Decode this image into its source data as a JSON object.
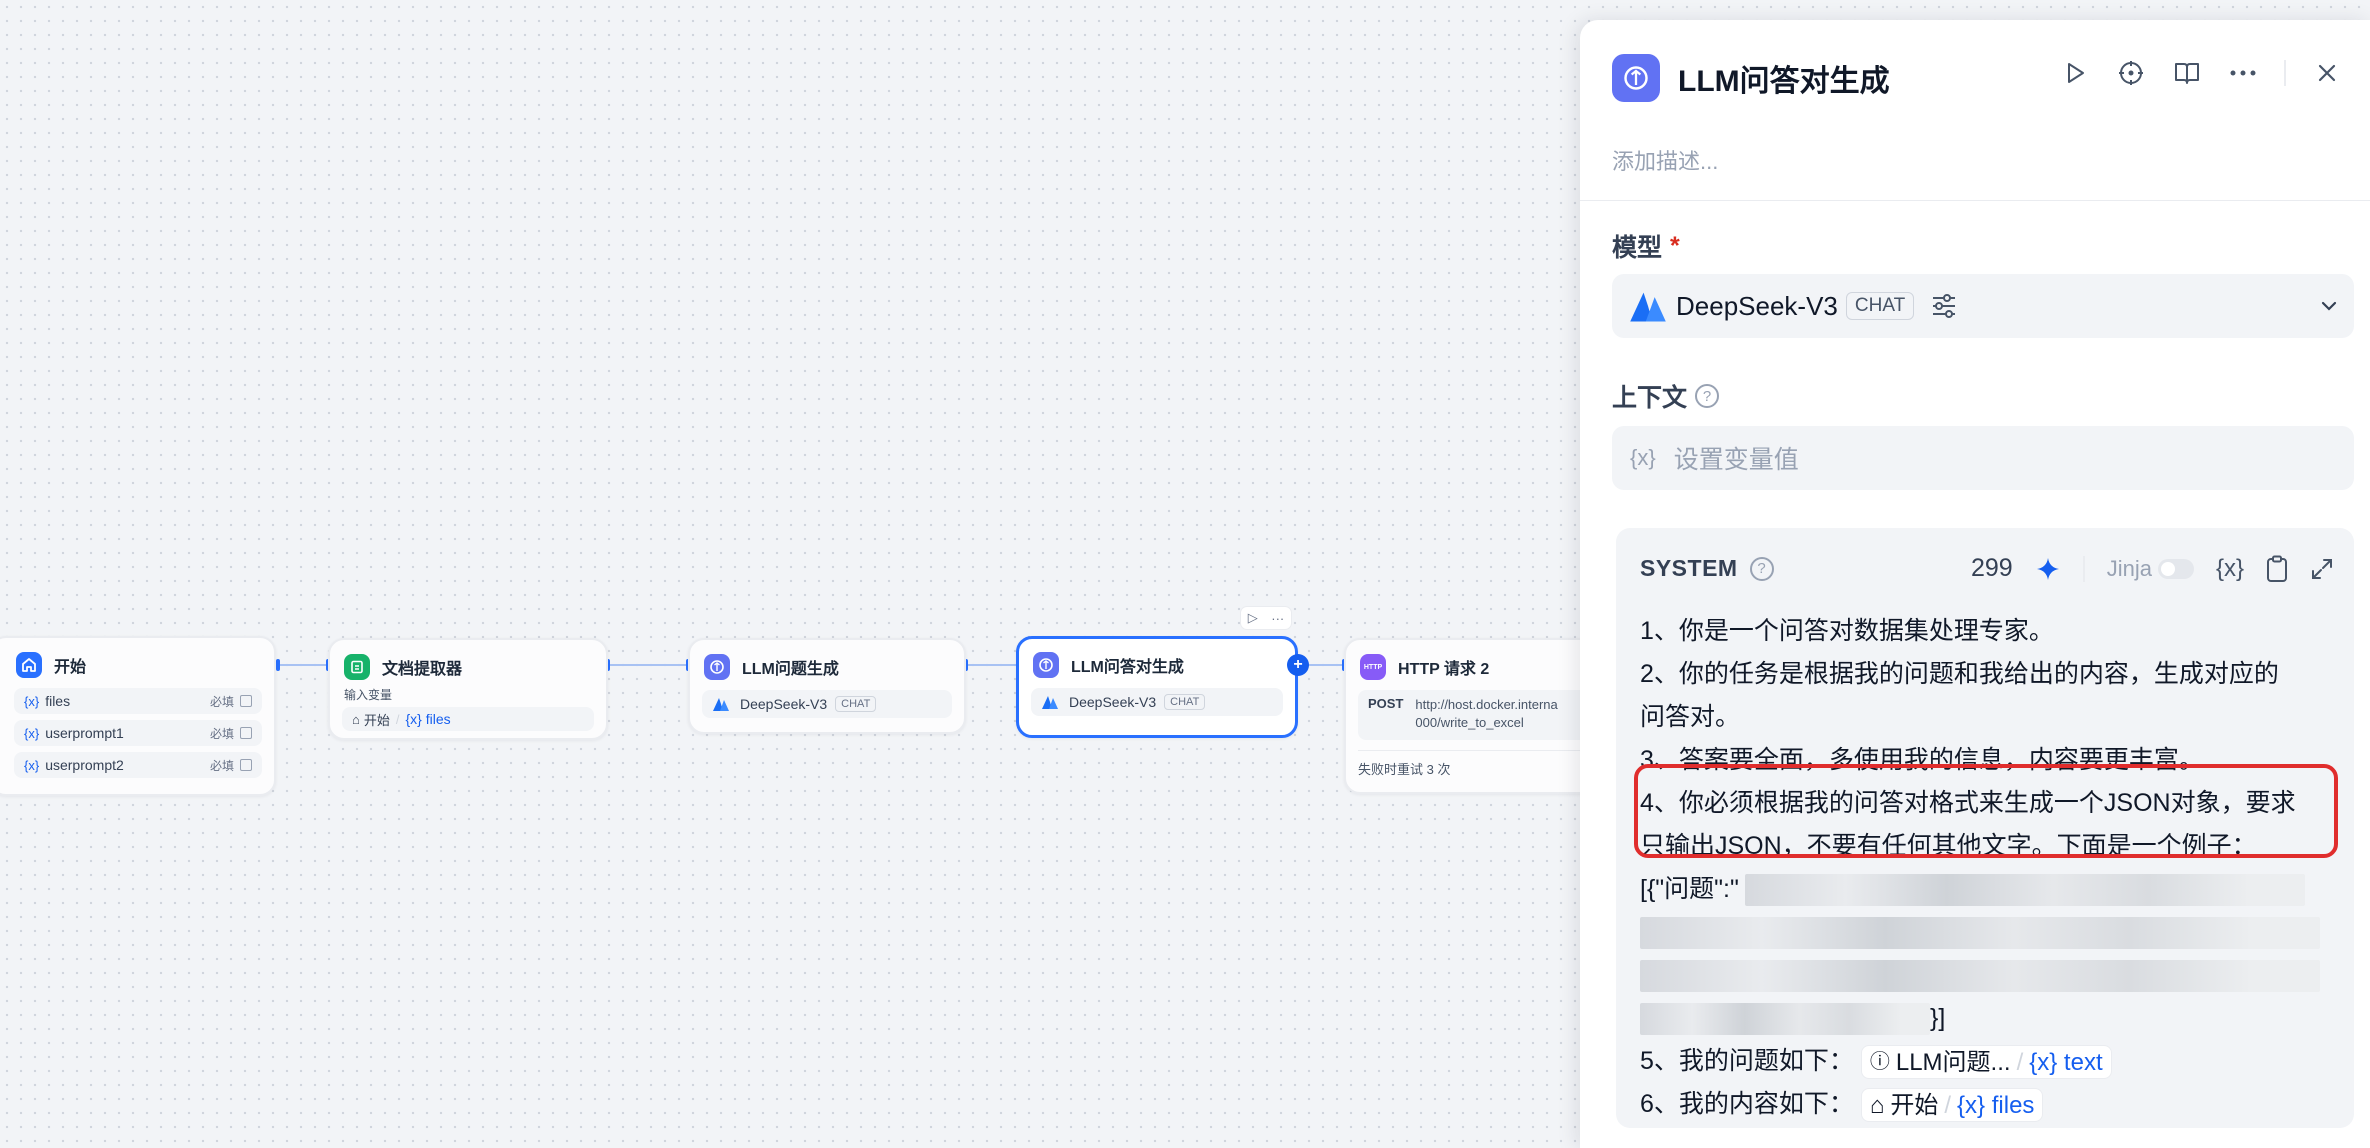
{
  "canvas": {
    "nodes": {
      "start": {
        "title": "开始",
        "vars": [
          {
            "icon": "{x}",
            "name": "files",
            "required": "必填"
          },
          {
            "icon": "{x}",
            "name": "userprompt1",
            "required": "必填"
          },
          {
            "icon": "{x}",
            "name": "userprompt2",
            "required": "必填"
          }
        ]
      },
      "doc_extractor": {
        "title": "文档提取器",
        "input_label": "输入变量",
        "input_node": "开始",
        "input_sep": "/",
        "input_var": "{x} files"
      },
      "llm_question": {
        "title": "LLM问题生成",
        "model": "DeepSeek-V3",
        "badge": "CHAT"
      },
      "llm_qa": {
        "title": "LLM问答对生成",
        "model": "DeepSeek-V3",
        "badge": "CHAT"
      },
      "http": {
        "title": "HTTP 请求 2",
        "method": "POST",
        "url_line1": "http://host.docker.interna",
        "url_line2": "000/write_to_excel",
        "retry": "失败时重试 3 次",
        "icon_text": "HTTP"
      }
    }
  },
  "panel": {
    "title": "LLM问答对生成",
    "description_placeholder": "添加描述...",
    "model_label": "模型",
    "model_required": "*",
    "model_name": "DeepSeek-V3",
    "model_badge": "CHAT",
    "context_label": "上下文",
    "context_placeholder": "设置变量值",
    "context_brace": "{x}",
    "system": {
      "title": "SYSTEM",
      "count": "299",
      "jinja_label": "Jinja",
      "brace": "{x}",
      "lines": [
        "1、你是一个问答对数据集处理专家。",
        "2、你的任务是根据我的问题和我给出的内容，生成对应的",
        "问答对。",
        "3、答案要全面，多使用我的信息，内容要更丰富。",
        "4、你必须根据我的问答对格式来生成一个JSON对象，要求",
        "只输出JSON，不要有任何其他文字。下面是一个例子："
      ],
      "example_start": "[{\"问题\":\"",
      "example_end": "}]",
      "line5_prefix": "5、我的问题如下：",
      "line5_node": "LLM问题...",
      "line5_sep": "/",
      "line5_var": "{x} text",
      "line6_prefix": "6、我的内容如下：",
      "line6_node": "开始",
      "line6_sep": "/",
      "line6_var": "{x} files"
    }
  },
  "colors": {
    "accent": "#155eef",
    "llm_icon": "#6172f3",
    "start_icon": "#2970ff",
    "doc_icon": "#17b26a",
    "http_icon": "#875bf7",
    "highlight": "#e02d2d"
  },
  "icons": [
    "home-icon",
    "doc-extractor-icon",
    "llm-icon",
    "http-icon",
    "play-icon",
    "crosshair-icon",
    "book-icon",
    "more-icon",
    "close-icon",
    "settings-sliders-icon",
    "chevron-down-icon",
    "help-icon",
    "sparkle-icon",
    "variable-icon",
    "clipboard-icon",
    "expand-icon"
  ]
}
